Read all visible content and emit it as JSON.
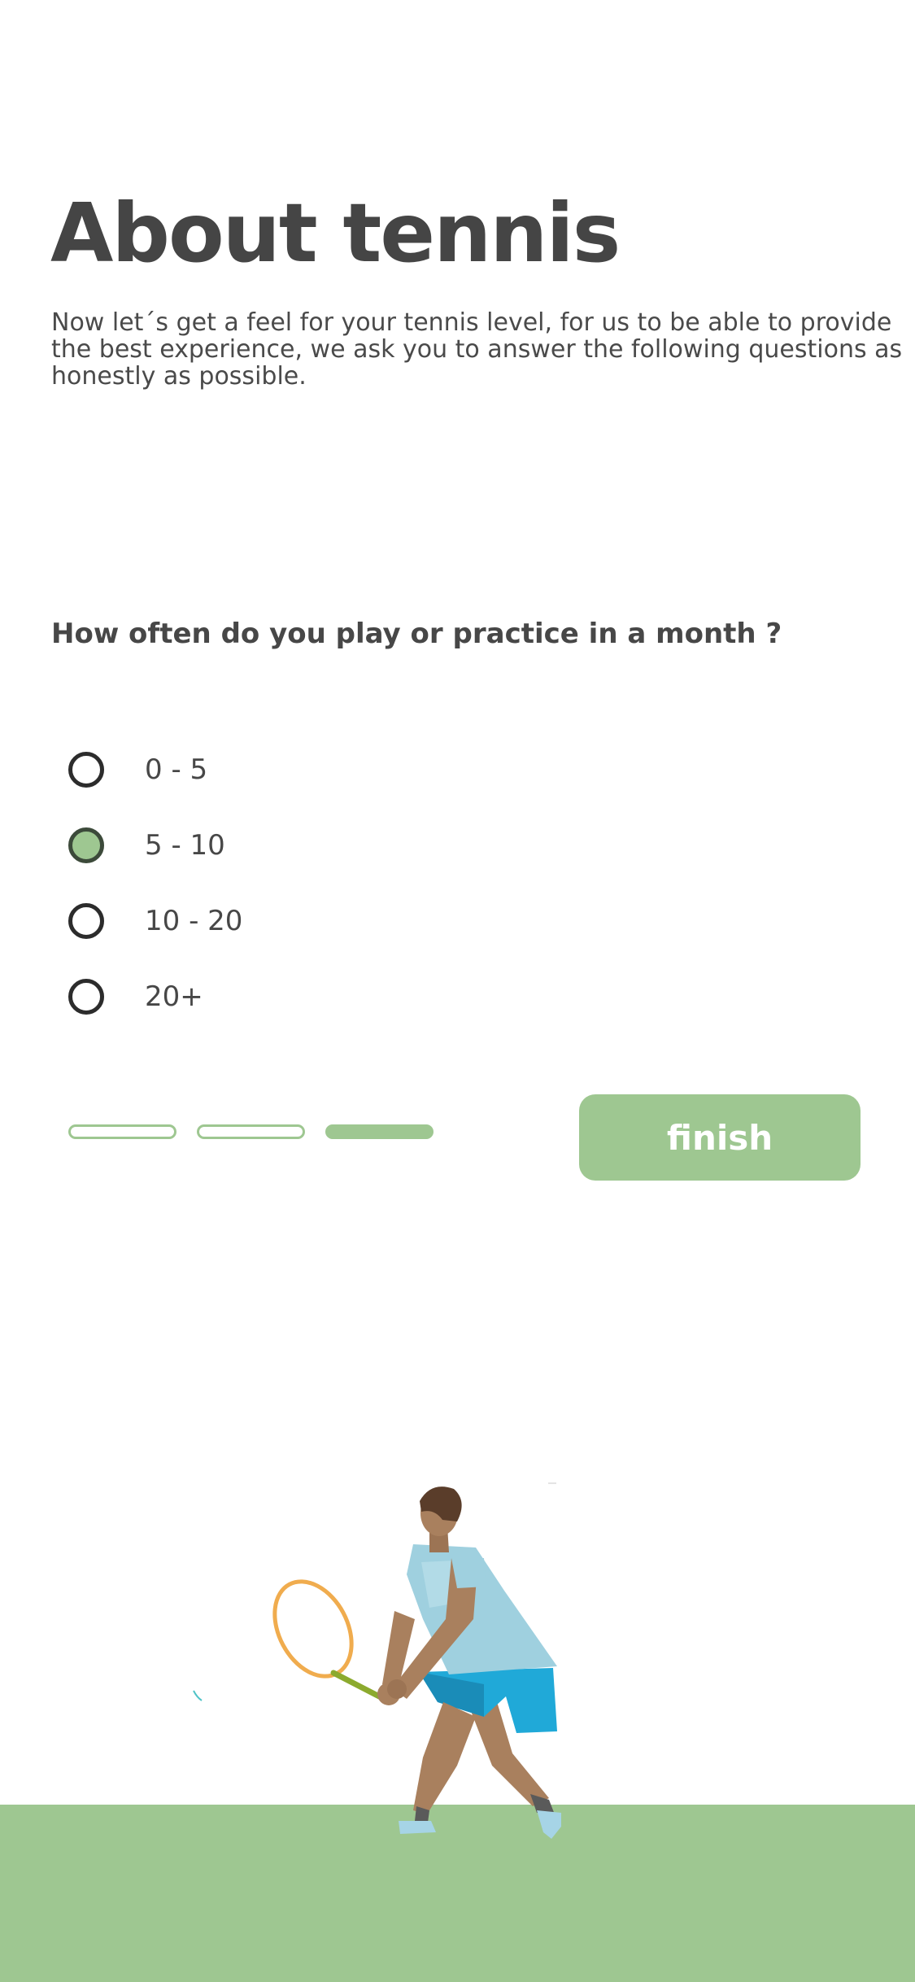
{
  "header": {
    "title": "About tennis",
    "intro": "Now let´s get a feel for your tennis level, for us to be able to provide the best experience, we ask you to answer the following questions as honestly as possible."
  },
  "question": {
    "text": "How often do you play or practice in a month ?",
    "options": [
      {
        "label": "0 - 5",
        "selected": false
      },
      {
        "label": "5 - 10",
        "selected": true
      },
      {
        "label": "10 - 20",
        "selected": false
      },
      {
        "label": "20+",
        "selected": false
      }
    ]
  },
  "progress": {
    "steps_total": 3,
    "current_step": 3
  },
  "actions": {
    "finish_label": "finish"
  },
  "illustration": {
    "subject": "tennis-player-icon"
  },
  "colors": {
    "accent": "#9ec791",
    "text": "#474747",
    "background": "#ffffff"
  }
}
